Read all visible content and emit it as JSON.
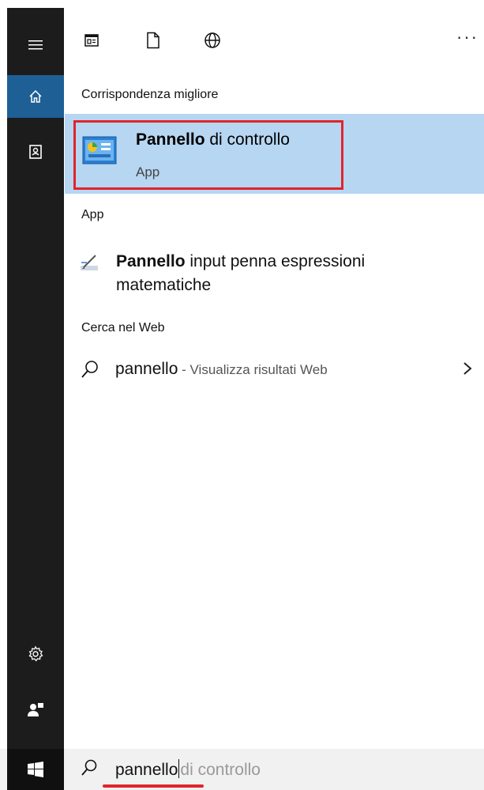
{
  "toolbar": {
    "icons": [
      "app-window-icon",
      "document-icon",
      "globe-icon"
    ],
    "more_label": "···"
  },
  "rail": {
    "icons": [
      "hamburger-menu-icon",
      "home-icon",
      "notebook-icon",
      "settings-icon",
      "feedback-person-icon",
      "windows-start-icon"
    ],
    "active": "home"
  },
  "best_match": {
    "heading": "Corrispondenza migliore",
    "title_bold": "Pannello",
    "title_rest": " di controllo",
    "subtitle": "App",
    "icon": "control-panel-icon"
  },
  "apps": {
    "heading": "App",
    "items": [
      {
        "bold": "Pannello",
        "rest": " input penna espressioni matematiche",
        "icon": "pen-input-icon"
      }
    ]
  },
  "web": {
    "heading": "Cerca nel Web",
    "query": "pannello",
    "suffix": " - Visualizza risultati Web"
  },
  "search": {
    "typed": "pannello",
    "hint": "di controllo"
  },
  "colors": {
    "rail": "#1c1c1c",
    "rail_active": "#1e5f96",
    "selection": "#b6d6f2",
    "highlight": "#e0252b"
  }
}
